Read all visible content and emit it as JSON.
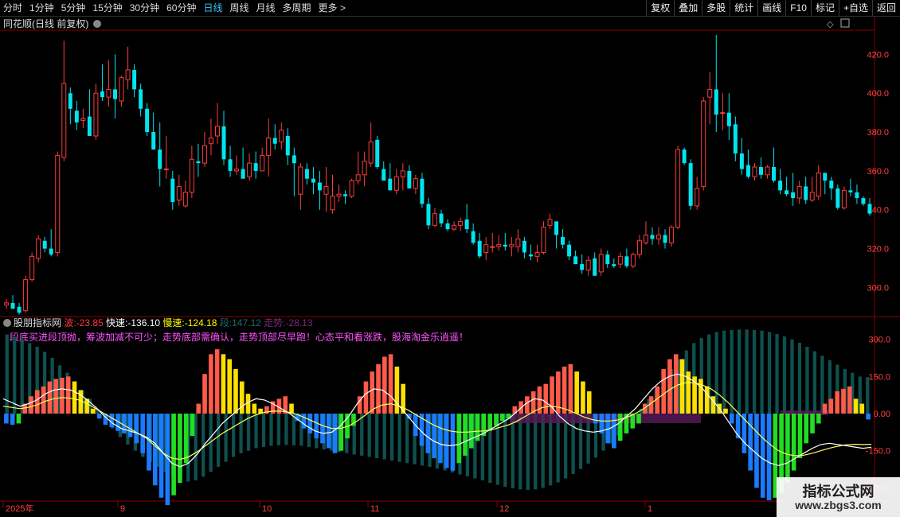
{
  "toolbar": {
    "periods": [
      "分时",
      "1分钟",
      "5分钟",
      "15分钟",
      "30分钟",
      "60分钟",
      "日线",
      "周线",
      "月线",
      "多周期",
      "更多 >"
    ],
    "active_period": "日线",
    "right_buttons": [
      "复权",
      "叠加",
      "多股",
      "统计",
      "画线",
      "F10",
      "标记",
      "+自选",
      "返回"
    ]
  },
  "main_panel": {
    "title": "同花顺(日线 前复权)",
    "price_ticks": [
      "420.0",
      "400.0",
      "380.0",
      "360.0",
      "340.0",
      "320.0",
      "300.0"
    ]
  },
  "indicator": {
    "name": "股朋指标网",
    "values": [
      {
        "label": "波",
        "value": "-23.85",
        "color": "#ff3b3b"
      },
      {
        "label": "快速",
        "value": "-136.10",
        "color": "#ffffff"
      },
      {
        "label": "慢速",
        "value": "-124.18",
        "color": "#ffff00"
      },
      {
        "label": "段",
        "value": "147.12",
        "color": "#1a6e6e"
      },
      {
        "label": "走势",
        "value": "-28.13",
        "color": "#7a2a7a"
      }
    ],
    "slogan": "段底买进段顶抛，筹波加减不可少；走势底部需确认，走势顶部尽早跑！心态平和看涨跌，股海淘金乐逍遥！",
    "ticks": [
      "300.0",
      "150.0",
      "0.00",
      "-150.0",
      "-300.0"
    ]
  },
  "date_axis": [
    "2025年",
    "9",
    "10",
    "11",
    "12",
    "1"
  ],
  "watermark": {
    "line1": "指标公式网",
    "line2": "www.zbgs3.com"
  },
  "colors": {
    "up": "#ff3c3c",
    "down": "#00e5ee",
    "grid": "#8b0000",
    "text": "#d0d0d0"
  },
  "chart_data": {
    "type": "candlestick",
    "price_ylim": [
      285,
      430
    ],
    "candles": [
      {
        "o": 291,
        "h": 294,
        "l": 289,
        "c": 292
      },
      {
        "o": 292,
        "h": 296,
        "l": 290,
        "c": 289
      },
      {
        "o": 290,
        "h": 292,
        "l": 286,
        "c": 287
      },
      {
        "o": 288,
        "h": 306,
        "l": 287,
        "c": 304
      },
      {
        "o": 304,
        "h": 318,
        "l": 303,
        "c": 316
      },
      {
        "o": 315,
        "h": 327,
        "l": 313,
        "c": 325
      },
      {
        "o": 324,
        "h": 326,
        "l": 318,
        "c": 320
      },
      {
        "o": 320,
        "h": 330,
        "l": 316,
        "c": 317
      },
      {
        "o": 318,
        "h": 370,
        "l": 316,
        "c": 368
      },
      {
        "o": 367,
        "h": 427,
        "l": 365,
        "c": 405
      },
      {
        "o": 400,
        "h": 403,
        "l": 384,
        "c": 392
      },
      {
        "o": 391,
        "h": 396,
        "l": 381,
        "c": 385
      },
      {
        "o": 386,
        "h": 392,
        "l": 382,
        "c": 387
      },
      {
        "o": 388,
        "h": 402,
        "l": 381,
        "c": 378
      },
      {
        "o": 378,
        "h": 405,
        "l": 376,
        "c": 400
      },
      {
        "o": 401,
        "h": 415,
        "l": 396,
        "c": 398
      },
      {
        "o": 398,
        "h": 417,
        "l": 393,
        "c": 402
      },
      {
        "o": 402,
        "h": 420,
        "l": 387,
        "c": 397
      },
      {
        "o": 396,
        "h": 409,
        "l": 393,
        "c": 408
      },
      {
        "o": 407,
        "h": 424,
        "l": 402,
        "c": 412
      },
      {
        "o": 412,
        "h": 415,
        "l": 398,
        "c": 402
      },
      {
        "o": 402,
        "h": 405,
        "l": 388,
        "c": 392
      },
      {
        "o": 392,
        "h": 395,
        "l": 378,
        "c": 380
      },
      {
        "o": 380,
        "h": 390,
        "l": 374,
        "c": 371
      },
      {
        "o": 371,
        "h": 385,
        "l": 352,
        "c": 361
      },
      {
        "o": 361,
        "h": 378,
        "l": 356,
        "c": 361
      },
      {
        "o": 356,
        "h": 360,
        "l": 340,
        "c": 344
      },
      {
        "o": 345,
        "h": 358,
        "l": 342,
        "c": 352
      },
      {
        "o": 342,
        "h": 355,
        "l": 341,
        "c": 349
      },
      {
        "o": 349,
        "h": 373,
        "l": 346,
        "c": 366
      },
      {
        "o": 365,
        "h": 374,
        "l": 357,
        "c": 364
      },
      {
        "o": 364,
        "h": 380,
        "l": 362,
        "c": 373
      },
      {
        "o": 374,
        "h": 387,
        "l": 368,
        "c": 377
      },
      {
        "o": 378,
        "h": 395,
        "l": 374,
        "c": 383
      },
      {
        "o": 383,
        "h": 391,
        "l": 363,
        "c": 366
      },
      {
        "o": 366,
        "h": 373,
        "l": 357,
        "c": 360
      },
      {
        "o": 360,
        "h": 368,
        "l": 358,
        "c": 361
      },
      {
        "o": 361,
        "h": 372,
        "l": 356,
        "c": 356
      },
      {
        "o": 357,
        "h": 369,
        "l": 355,
        "c": 364
      },
      {
        "o": 364,
        "h": 370,
        "l": 356,
        "c": 360
      },
      {
        "o": 360,
        "h": 372,
        "l": 360,
        "c": 368
      },
      {
        "o": 368,
        "h": 387,
        "l": 357,
        "c": 377
      },
      {
        "o": 377,
        "h": 384,
        "l": 371,
        "c": 374
      },
      {
        "o": 375,
        "h": 385,
        "l": 371,
        "c": 381
      },
      {
        "o": 378,
        "h": 382,
        "l": 363,
        "c": 368
      },
      {
        "o": 368,
        "h": 372,
        "l": 347,
        "c": 364
      },
      {
        "o": 348,
        "h": 364,
        "l": 340,
        "c": 362
      },
      {
        "o": 361,
        "h": 364,
        "l": 353,
        "c": 356
      },
      {
        "o": 356,
        "h": 362,
        "l": 348,
        "c": 354
      },
      {
        "o": 354,
        "h": 360,
        "l": 340,
        "c": 350
      },
      {
        "o": 348,
        "h": 362,
        "l": 339,
        "c": 352
      },
      {
        "o": 340,
        "h": 358,
        "l": 338,
        "c": 347
      },
      {
        "o": 347,
        "h": 353,
        "l": 344,
        "c": 348
      },
      {
        "o": 348,
        "h": 350,
        "l": 343,
        "c": 347
      },
      {
        "o": 347,
        "h": 356,
        "l": 346,
        "c": 355
      },
      {
        "o": 355,
        "h": 370,
        "l": 353,
        "c": 358
      },
      {
        "o": 358,
        "h": 370,
        "l": 352,
        "c": 365
      },
      {
        "o": 364,
        "h": 385,
        "l": 362,
        "c": 375
      },
      {
        "o": 376,
        "h": 378,
        "l": 361,
        "c": 362
      },
      {
        "o": 361,
        "h": 365,
        "l": 357,
        "c": 355
      },
      {
        "o": 356,
        "h": 364,
        "l": 350,
        "c": 350
      },
      {
        "o": 350,
        "h": 361,
        "l": 348,
        "c": 357
      },
      {
        "o": 357,
        "h": 364,
        "l": 350,
        "c": 360
      },
      {
        "o": 360,
        "h": 363,
        "l": 354,
        "c": 351
      },
      {
        "o": 351,
        "h": 358,
        "l": 348,
        "c": 356
      },
      {
        "o": 356,
        "h": 359,
        "l": 341,
        "c": 343
      },
      {
        "o": 343,
        "h": 346,
        "l": 330,
        "c": 332
      },
      {
        "o": 332,
        "h": 341,
        "l": 331,
        "c": 338
      },
      {
        "o": 338,
        "h": 340,
        "l": 331,
        "c": 333
      },
      {
        "o": 333,
        "h": 335,
        "l": 329,
        "c": 330
      },
      {
        "o": 330,
        "h": 334,
        "l": 329,
        "c": 332
      },
      {
        "o": 332,
        "h": 336,
        "l": 329,
        "c": 334
      },
      {
        "o": 335,
        "h": 343,
        "l": 328,
        "c": 330
      },
      {
        "o": 329,
        "h": 333,
        "l": 322,
        "c": 323
      },
      {
        "o": 324,
        "h": 328,
        "l": 315,
        "c": 316
      },
      {
        "o": 318,
        "h": 326,
        "l": 314,
        "c": 322
      },
      {
        "o": 321,
        "h": 328,
        "l": 318,
        "c": 321
      },
      {
        "o": 321,
        "h": 327,
        "l": 319,
        "c": 322
      },
      {
        "o": 322,
        "h": 328,
        "l": 319,
        "c": 321
      },
      {
        "o": 321,
        "h": 326,
        "l": 316,
        "c": 322
      },
      {
        "o": 321,
        "h": 330,
        "l": 318,
        "c": 325
      },
      {
        "o": 324,
        "h": 326,
        "l": 315,
        "c": 318
      },
      {
        "o": 317,
        "h": 322,
        "l": 314,
        "c": 316
      },
      {
        "o": 316,
        "h": 322,
        "l": 313,
        "c": 318
      },
      {
        "o": 318,
        "h": 334,
        "l": 317,
        "c": 331
      },
      {
        "o": 332,
        "h": 338,
        "l": 330,
        "c": 335
      },
      {
        "o": 334,
        "h": 333,
        "l": 320,
        "c": 327
      },
      {
        "o": 326,
        "h": 330,
        "l": 320,
        "c": 322
      },
      {
        "o": 322,
        "h": 324,
        "l": 314,
        "c": 316
      },
      {
        "o": 316,
        "h": 319,
        "l": 312,
        "c": 312
      },
      {
        "o": 312,
        "h": 317,
        "l": 307,
        "c": 309
      },
      {
        "o": 309,
        "h": 316,
        "l": 306,
        "c": 314
      },
      {
        "o": 315,
        "h": 318,
        "l": 306,
        "c": 306
      },
      {
        "o": 308,
        "h": 320,
        "l": 306,
        "c": 317
      },
      {
        "o": 317,
        "h": 319,
        "l": 310,
        "c": 312
      },
      {
        "o": 312,
        "h": 315,
        "l": 310,
        "c": 311
      },
      {
        "o": 312,
        "h": 318,
        "l": 310,
        "c": 316
      },
      {
        "o": 316,
        "h": 320,
        "l": 310,
        "c": 311
      },
      {
        "o": 311,
        "h": 318,
        "l": 310,
        "c": 317
      },
      {
        "o": 317,
        "h": 327,
        "l": 315,
        "c": 324
      },
      {
        "o": 323,
        "h": 334,
        "l": 322,
        "c": 327
      },
      {
        "o": 327,
        "h": 331,
        "l": 322,
        "c": 325
      },
      {
        "o": 325,
        "h": 331,
        "l": 322,
        "c": 327
      },
      {
        "o": 327,
        "h": 330,
        "l": 320,
        "c": 323
      },
      {
        "o": 323,
        "h": 332,
        "l": 321,
        "c": 331
      },
      {
        "o": 331,
        "h": 373,
        "l": 330,
        "c": 371
      },
      {
        "o": 371,
        "h": 372,
        "l": 363,
        "c": 364
      },
      {
        "o": 364,
        "h": 366,
        "l": 340,
        "c": 342
      },
      {
        "o": 342,
        "h": 357,
        "l": 340,
        "c": 351
      },
      {
        "o": 352,
        "h": 398,
        "l": 350,
        "c": 396
      },
      {
        "o": 398,
        "h": 411,
        "l": 384,
        "c": 402
      },
      {
        "o": 402,
        "h": 430,
        "l": 380,
        "c": 389
      },
      {
        "o": 390,
        "h": 400,
        "l": 381,
        "c": 390
      },
      {
        "o": 390,
        "h": 400,
        "l": 376,
        "c": 383
      },
      {
        "o": 384,
        "h": 388,
        "l": 365,
        "c": 369
      },
      {
        "o": 369,
        "h": 377,
        "l": 358,
        "c": 361
      },
      {
        "o": 363,
        "h": 371,
        "l": 356,
        "c": 357
      },
      {
        "o": 357,
        "h": 364,
        "l": 355,
        "c": 362
      },
      {
        "o": 362,
        "h": 367,
        "l": 356,
        "c": 358
      },
      {
        "o": 358,
        "h": 363,
        "l": 356,
        "c": 362
      },
      {
        "o": 362,
        "h": 372,
        "l": 354,
        "c": 355
      },
      {
        "o": 355,
        "h": 361,
        "l": 348,
        "c": 350
      },
      {
        "o": 350,
        "h": 357,
        "l": 347,
        "c": 348
      },
      {
        "o": 349,
        "h": 359,
        "l": 342,
        "c": 346
      },
      {
        "o": 346,
        "h": 355,
        "l": 343,
        "c": 352
      },
      {
        "o": 352,
        "h": 357,
        "l": 343,
        "c": 345
      },
      {
        "o": 345,
        "h": 357,
        "l": 344,
        "c": 349
      },
      {
        "o": 347,
        "h": 363,
        "l": 345,
        "c": 359
      },
      {
        "o": 359,
        "h": 358,
        "l": 348,
        "c": 355
      },
      {
        "o": 355,
        "h": 357,
        "l": 345,
        "c": 351
      },
      {
        "o": 351,
        "h": 353,
        "l": 340,
        "c": 341
      },
      {
        "o": 341,
        "h": 352,
        "l": 340,
        "c": 350
      },
      {
        "o": 350,
        "h": 356,
        "l": 347,
        "c": 349
      },
      {
        "o": 349,
        "h": 353,
        "l": 343,
        "c": 346
      },
      {
        "o": 346,
        "h": 347,
        "l": 342,
        "c": 343
      },
      {
        "o": 343,
        "h": 346,
        "l": 337,
        "c": 338
      }
    ],
    "indicator_ylim": [
      -360,
      360
    ],
    "wave_bars": [
      -40,
      -45,
      -40,
      40,
      70,
      95,
      110,
      130,
      140,
      145,
      150,
      130,
      95,
      60,
      20,
      -20,
      -45,
      -55,
      -70,
      -80,
      -95,
      -120,
      -160,
      -230,
      -290,
      -340,
      -370,
      -330,
      -280,
      -200,
      -90,
      40,
      160,
      240,
      260,
      240,
      220,
      180,
      130,
      80,
      40,
      20,
      30,
      50,
      60,
      70,
      40,
      -30,
      -60,
      -80,
      -100,
      -120,
      -140,
      -160,
      -150,
      -100,
      -50,
      70,
      130,
      170,
      200,
      230,
      240,
      190,
      120,
      -20,
      -90,
      -130,
      -160,
      -180,
      -200,
      -220,
      -230,
      -200,
      -170,
      -140,
      -110,
      -90,
      -70,
      -50,
      -30,
      -20,
      30,
      50,
      70,
      90,
      110,
      120,
      150,
      170,
      190,
      200,
      170,
      130,
      90,
      -40,
      -80,
      -120,
      -140,
      -110,
      -80,
      -60,
      -40,
      40,
      70,
      110,
      180,
      220,
      240,
      220,
      170,
      150,
      140,
      110,
      70,
      40,
      20,
      -40,
      -100,
      -160,
      -230,
      -300,
      -340,
      -350,
      -340,
      -320,
      -280,
      -230,
      -180,
      -120,
      -80,
      -40,
      40,
      60,
      90,
      100,
      110,
      60,
      40,
      -23.85
    ],
    "seg_bars": [
      320,
      310,
      300,
      285,
      270,
      250,
      225,
      195,
      165,
      130,
      95,
      60,
      20,
      -20,
      -60,
      -95,
      -125,
      -150,
      -175,
      -195,
      -215,
      -235,
      -255,
      -270,
      -275,
      -270,
      -255,
      -235,
      -215,
      -195,
      -175,
      -160,
      -150,
      -140,
      -135,
      -130,
      -128,
      -127,
      -128,
      -130,
      -135,
      -140,
      -145,
      -150,
      -155,
      -160,
      -165,
      -170,
      -175,
      -180,
      -185,
      -190,
      -195,
      -200,
      -205,
      -210,
      -215,
      -222,
      -230,
      -238,
      -246,
      -254,
      -262,
      -270,
      -280,
      -288,
      -296,
      -302,
      -306,
      -308,
      -306,
      -300,
      -290,
      -278,
      -262,
      -244,
      -224,
      -202,
      -178,
      -150,
      -120,
      -88,
      -55,
      -20,
      20,
      60,
      100,
      140,
      180,
      220,
      255,
      285,
      305,
      320,
      330,
      335,
      338,
      340,
      340,
      338,
      335,
      330,
      322,
      312,
      300,
      286,
      270,
      252,
      234,
      216,
      198,
      180,
      165,
      150,
      147.12
    ],
    "trend_bars_note": "purple",
    "fast_line": [
      60,
      45,
      30,
      40,
      55,
      80,
      95,
      100,
      95,
      80,
      55,
      25,
      -10,
      -40,
      -60,
      -70,
      -80,
      -95,
      -120,
      -160,
      -200,
      -215,
      -200,
      -165,
      -120,
      -80,
      -40,
      -10,
      20,
      45,
      60,
      55,
      40,
      20,
      0,
      -25,
      -50,
      -70,
      -80,
      -75,
      -50,
      -10,
      40,
      80,
      100,
      95,
      70,
      30,
      -10,
      -50,
      -85,
      -110,
      -125,
      -130,
      -125,
      -110,
      -95,
      -80,
      -60,
      -40,
      -20,
      10,
      40,
      60,
      55,
      30,
      -10,
      -40,
      -60,
      -70,
      -75,
      -70,
      -60,
      -40,
      -10,
      20,
      60,
      100,
      130,
      150,
      160,
      150,
      130,
      100,
      60,
      20,
      -30,
      -80,
      -120,
      -150,
      -180,
      -200,
      -210,
      -200,
      -180,
      -160,
      -140,
      -125,
      -120,
      -125,
      -130,
      -135,
      -140,
      -136.1
    ],
    "slow_line": [
      30,
      25,
      20,
      25,
      35,
      50,
      60,
      65,
      62,
      55,
      40,
      20,
      0,
      -20,
      -40,
      -60,
      -80,
      -100,
      -130,
      -160,
      -180,
      -185,
      -175,
      -155,
      -130,
      -105,
      -80,
      -60,
      -40,
      -20,
      -5,
      5,
      10,
      10,
      5,
      -5,
      -20,
      -35,
      -50,
      -60,
      -60,
      -50,
      -30,
      -5,
      20,
      35,
      40,
      30,
      15,
      -5,
      -25,
      -45,
      -60,
      -70,
      -75,
      -75,
      -72,
      -70,
      -65,
      -55,
      -45,
      -30,
      -10,
      10,
      25,
      30,
      25,
      15,
      0,
      -15,
      -25,
      -30,
      -30,
      -25,
      -15,
      0,
      20,
      45,
      70,
      95,
      115,
      125,
      125,
      115,
      100,
      75,
      45,
      10,
      -25,
      -60,
      -95,
      -125,
      -150,
      -165,
      -170,
      -168,
      -160,
      -150,
      -140,
      -132,
      -126,
      -124,
      -125,
      -124.18
    ]
  }
}
